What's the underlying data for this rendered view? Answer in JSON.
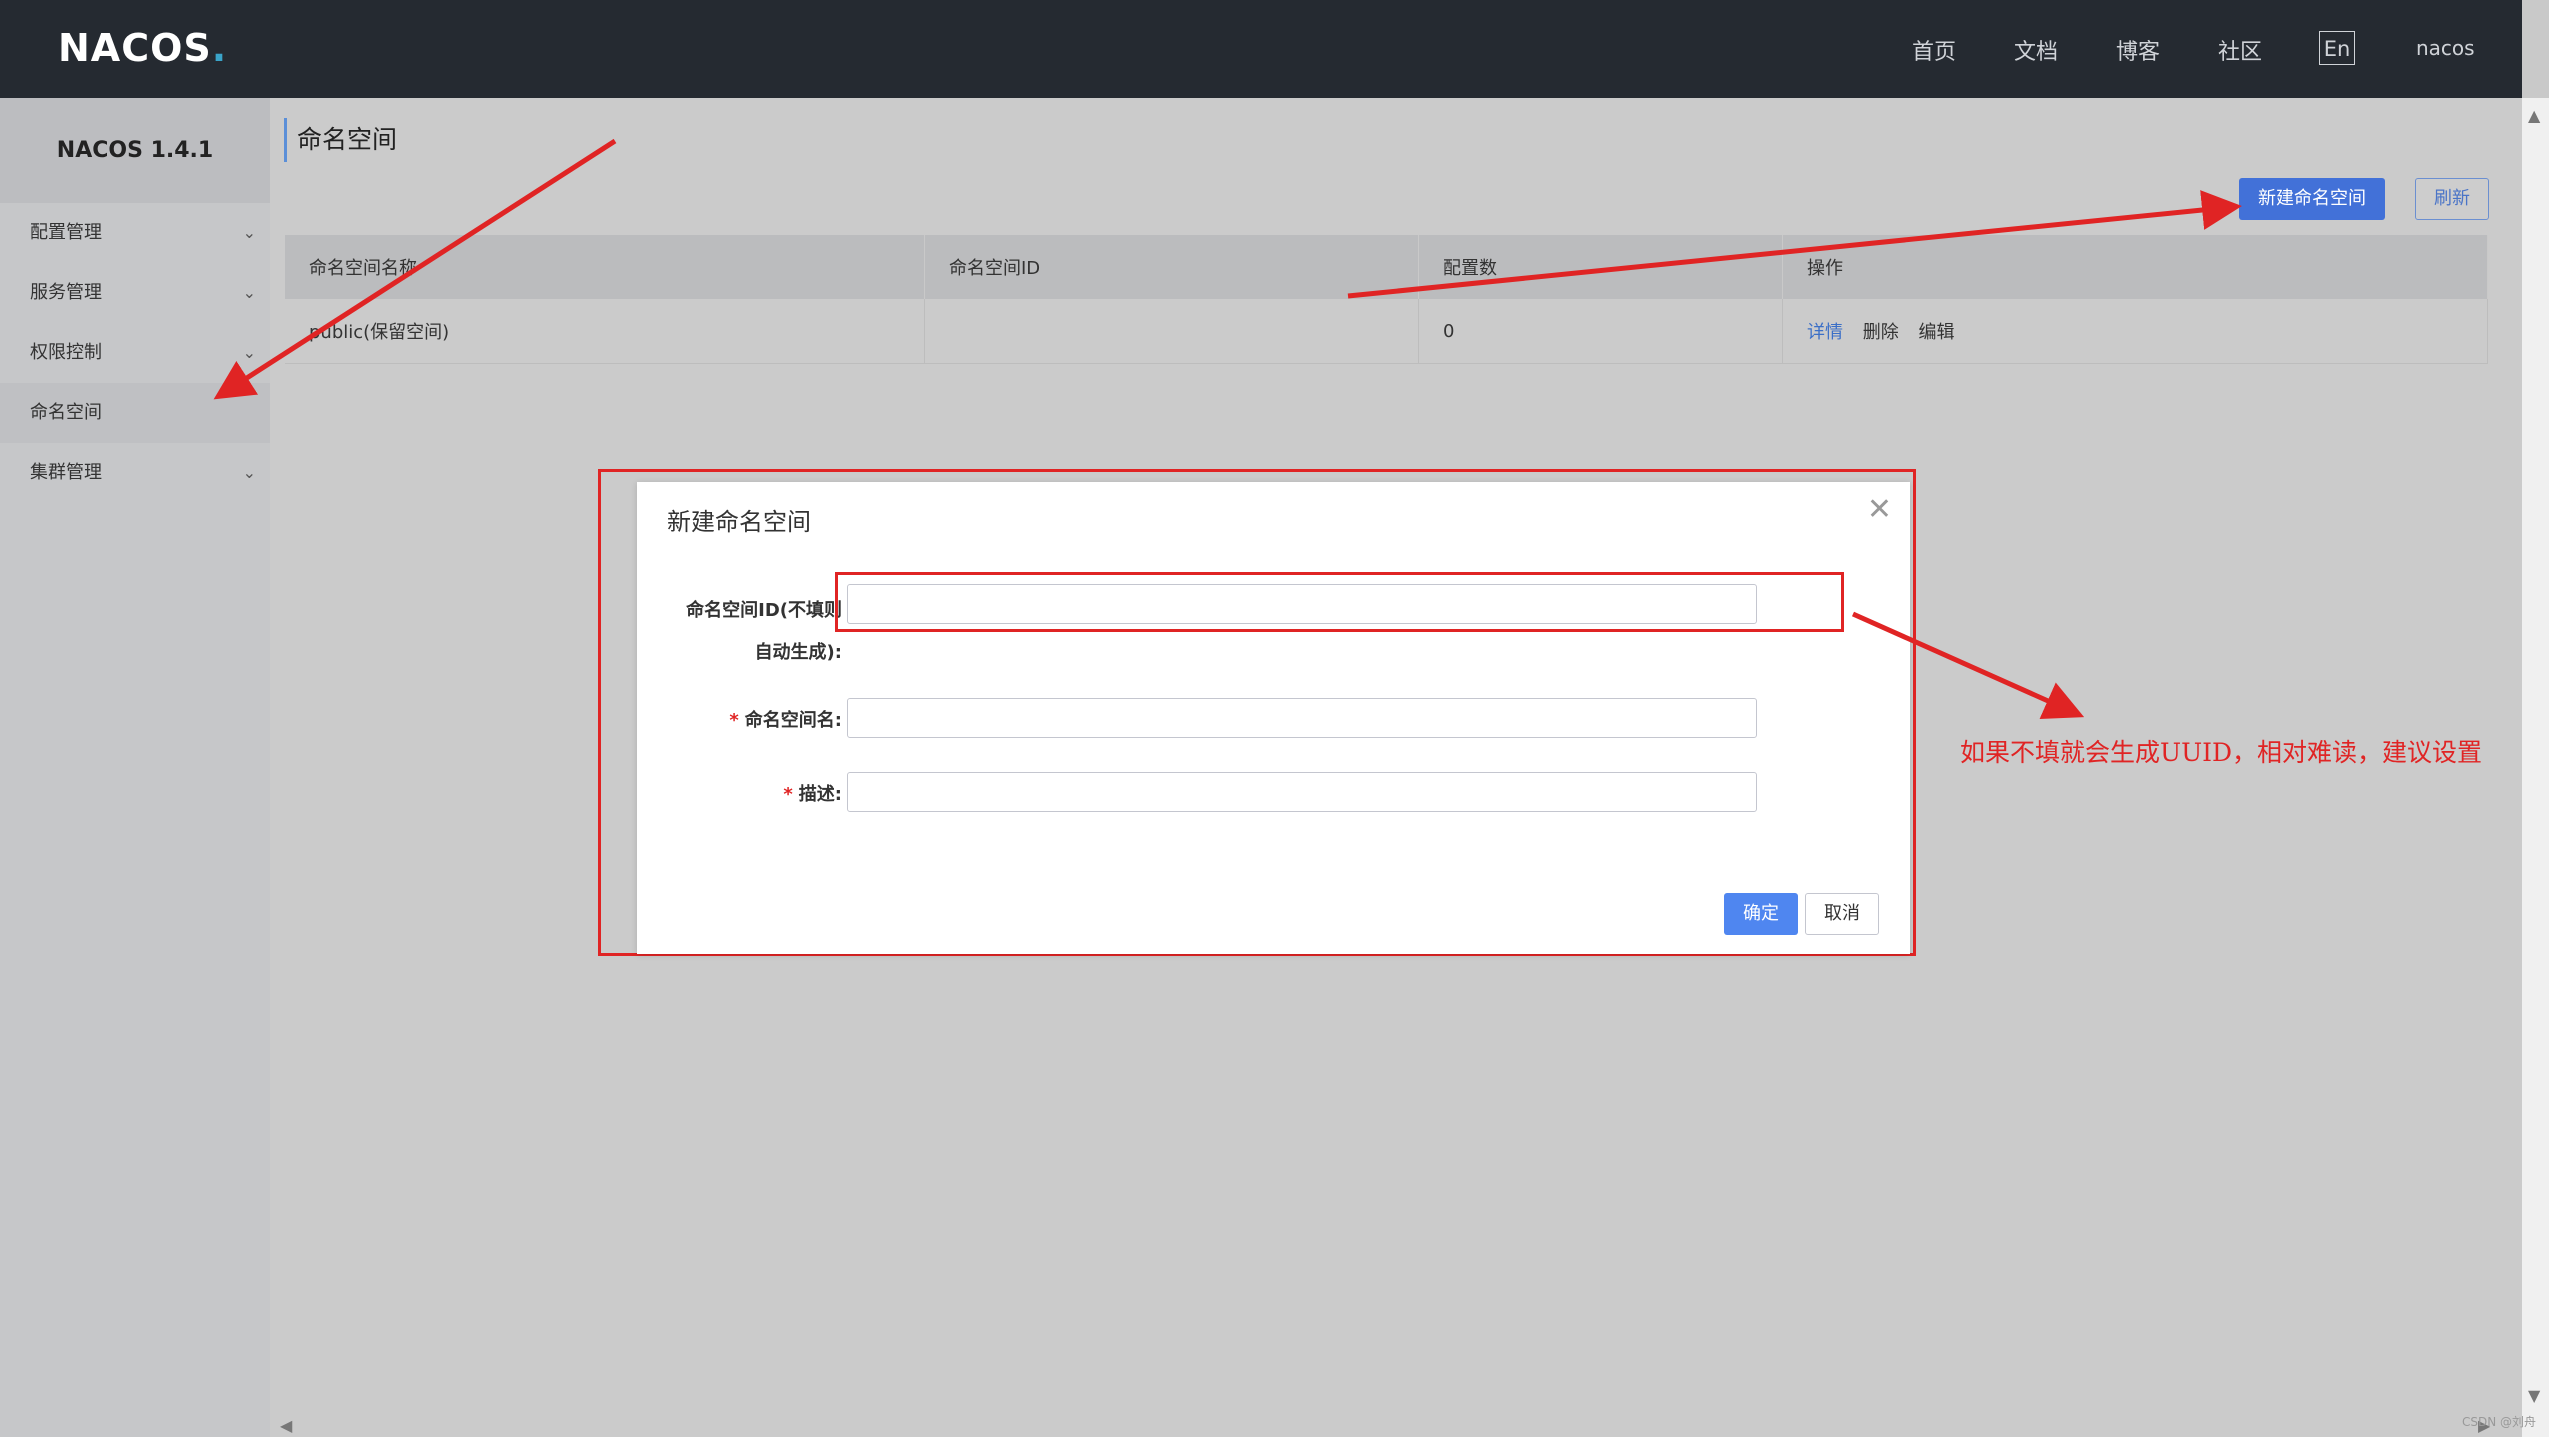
{
  "header": {
    "logo": "NACOS",
    "nav": [
      "首页",
      "文档",
      "博客",
      "社区"
    ],
    "lang": "En",
    "user": "nacos"
  },
  "sidebar": {
    "title": "NACOS 1.4.1",
    "items": [
      {
        "label": "配置管理",
        "chevron": true
      },
      {
        "label": "服务管理",
        "chevron": true
      },
      {
        "label": "权限控制",
        "chevron": true
      },
      {
        "label": "命名空间",
        "chevron": false,
        "active": true
      },
      {
        "label": "集群管理",
        "chevron": true
      }
    ]
  },
  "main": {
    "title": "命名空间",
    "new_button": "新建命名空间",
    "refresh_button": "刷新",
    "table": {
      "columns": [
        "命名空间名称",
        "命名空间ID",
        "配置数",
        "操作"
      ],
      "rows": [
        {
          "name": "public(保留空间)",
          "id": "",
          "count": "0",
          "ops": [
            "详情",
            "删除",
            "编辑"
          ]
        }
      ]
    }
  },
  "modal": {
    "title": "新建命名空间",
    "fields": {
      "id_label_line1": "命名空间ID(不填则",
      "id_label_line2": "自动生成):",
      "name_label": "命名空间名:",
      "desc_label": "描述:",
      "required_mark": "*"
    },
    "confirm": "确定",
    "cancel": "取消"
  },
  "annotation": "如果不填就会生成UUID，相对难读，建议设置",
  "colors": {
    "primary": "#4271d8",
    "annotation_red": "#e02424",
    "navbar": "#252a31"
  },
  "watermark": "CSDN @刘舟"
}
